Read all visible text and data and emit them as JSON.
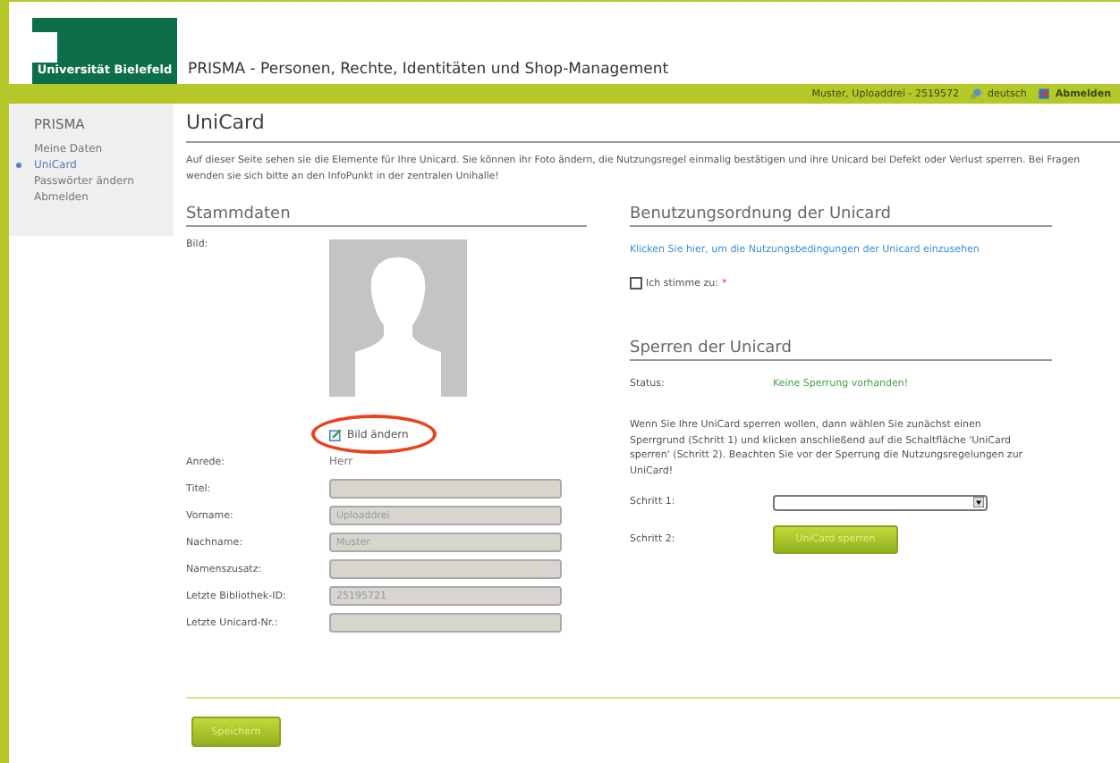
{
  "header": {
    "logo": "Universität Bielefeld",
    "title": "PRISMA - Personen, Rechte, Identitäten und Shop-Management"
  },
  "topbar": {
    "user": "Muster, Uploaddrei - 2519572",
    "language": "deutsch",
    "logout": "Abmelden"
  },
  "sidebar": {
    "title": "PRISMA",
    "items": [
      {
        "label": "Meine Daten",
        "selected": false
      },
      {
        "label": "UniCard",
        "selected": true
      },
      {
        "label": "Passwörter ändern",
        "selected": false
      },
      {
        "label": "Abmelden",
        "selected": false
      }
    ]
  },
  "page": {
    "title": "UniCard",
    "intro": "Auf dieser Seite sehen sie die Elemente für Ihre Unicard. Sie können ihr Foto ändern, die Nutzungsregel einmalig bestätigen und ihre Unicard bei Defekt oder Verlust sperren. Bei Fragen wenden sie sich bitte an den InfoPunkt in der zentralen Unihalle!"
  },
  "stammdaten": {
    "heading": "Stammdaten",
    "photo_label": "Bild:",
    "change_photo": "Bild ändern",
    "salutation_label": "Anrede:",
    "salutation": "Herr",
    "fields": [
      {
        "label": "Titel:"
      },
      {
        "label": "Vorname:",
        "value": "Uploaddrei"
      },
      {
        "label": "Nachname:",
        "value": "Muster"
      },
      {
        "label": "Namenszusatz:"
      },
      {
        "label": "Letzte Bibliothek-ID:",
        "value": "25195721"
      },
      {
        "label": "Letzte Unicard-Nr.:"
      }
    ]
  },
  "terms": {
    "heading": "Benutzungsordnung der Unicard",
    "link": "Klicken Sie hier, um die Nutzungsbedingungen der Unicard einzusehen",
    "agree_label": "Ich stimme zu:",
    "required_mark": "*",
    "checked": false
  },
  "block": {
    "heading": "Sperren der Unicard",
    "status_label": "Status:",
    "status": "Keine Sperrung vorhanden!",
    "text": "Wenn Sie Ihre UniCard sperren wollen, dann wählen Sie zunächst einen Sperrgrund (Schritt 1) und klicken anschließend auf die Schaltfläche 'UniCard sperren' (Schritt 2). Beachten Sie vor der Sperrung die Nutzungsregelungen zur UniCard!",
    "step1_label": "Schritt 1:",
    "step2_label": "Schritt 2:",
    "block_button": "UniCard sperren"
  },
  "save_button": "Speichern"
}
